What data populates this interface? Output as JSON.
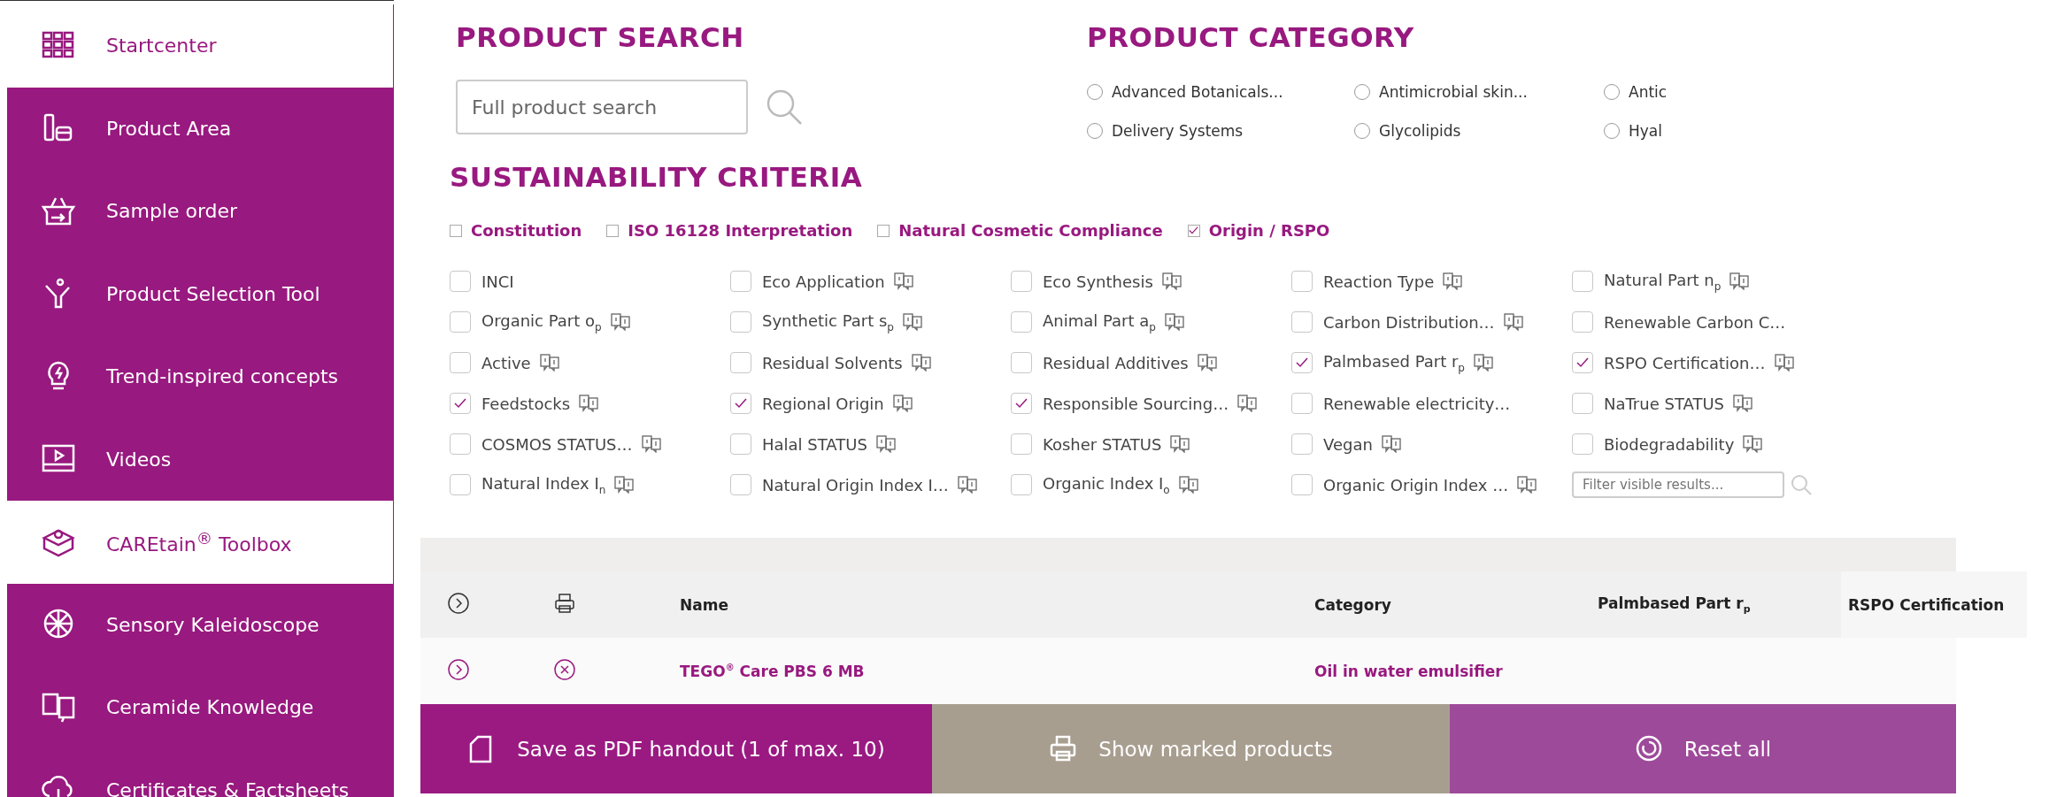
{
  "sidebar": {
    "items": [
      {
        "label": "Startcenter",
        "selected": true
      },
      {
        "label": "Product Area",
        "selected": false
      },
      {
        "label": "Sample order",
        "selected": false
      },
      {
        "label": "Product Selection Tool",
        "selected": false
      },
      {
        "label": "Trend-inspired concepts",
        "selected": false
      },
      {
        "label": "Videos",
        "selected": false
      },
      {
        "label": "CAREtain$^{®}$ Toolbox",
        "selected": true
      },
      {
        "label": "Sensory Kaleidoscope",
        "selected": false
      },
      {
        "label": "Ceramide Knowledge",
        "selected": false
      },
      {
        "label": "Certificates & Factsheets",
        "selected": false
      }
    ]
  },
  "product_search": {
    "title": "PRODUCT SEARCH",
    "placeholder": "Full product search"
  },
  "product_category": {
    "title": "PRODUCT CATEGORY",
    "options": [
      {
        "label": "Advanced Botanicals...",
        "selected": false
      },
      {
        "label": "Antimicrobial skin...",
        "selected": false
      },
      {
        "label": "Antic",
        "selected": false
      },
      {
        "label": "Delivery Systems",
        "selected": false
      },
      {
        "label": "Glycolipids",
        "selected": false
      },
      {
        "label": "Hyal",
        "selected": false
      }
    ]
  },
  "sustainability_criteria": {
    "title": "SUSTAINABILITY CRITERIA",
    "groups": [
      {
        "label": "Constitution",
        "checked": false
      },
      {
        "label": "ISO 16128 Interpretation",
        "checked": false
      },
      {
        "label": "Natural Cosmetic Compliance",
        "checked": false
      },
      {
        "label": "Origin / RSPO",
        "checked": true
      }
    ],
    "criteria": [
      {
        "label": "INCI",
        "checked": false,
        "info_icon": false
      },
      {
        "label": "Eco Application",
        "checked": false,
        "info_icon": true
      },
      {
        "label": "Eco Synthesis",
        "checked": false,
        "info_icon": true
      },
      {
        "label": "Reaction Type",
        "checked": false,
        "info_icon": true
      },
      {
        "label": "Natural Part n$_{p}$",
        "checked": false,
        "info_icon": true
      },
      {
        "label": "Organic Part o$_{p}$",
        "checked": false,
        "info_icon": true
      },
      {
        "label": "Synthetic Part s$_{p}$",
        "checked": false,
        "info_icon": true
      },
      {
        "label": "Animal Part a$_{p}$",
        "checked": false,
        "info_icon": true
      },
      {
        "label": "Carbon Distribution…",
        "checked": false,
        "info_icon": true
      },
      {
        "label": "Renewable Carbon C…",
        "checked": false,
        "info_icon": false
      },
      {
        "label": "Active",
        "checked": false,
        "info_icon": true
      },
      {
        "label": "Residual Solvents",
        "checked": false,
        "info_icon": true
      },
      {
        "label": "Residual Additives",
        "checked": false,
        "info_icon": true
      },
      {
        "label": "Palmbased Part r$_{p}$",
        "checked": true,
        "info_icon": true
      },
      {
        "label": "RSPO Certification…",
        "checked": true,
        "info_icon": true
      },
      {
        "label": "Feedstocks",
        "checked": true,
        "info_icon": true
      },
      {
        "label": "Regional Origin",
        "checked": true,
        "info_icon": true
      },
      {
        "label": "Responsible Sourcing…",
        "checked": true,
        "info_icon": true
      },
      {
        "label": "Renewable electricity…",
        "checked": false,
        "info_icon": false
      },
      {
        "label": "NaTrue STATUS",
        "checked": false,
        "info_icon": true
      },
      {
        "label": "COSMOS STATUS…",
        "checked": false,
        "info_icon": true
      },
      {
        "label": "Halal STATUS",
        "checked": false,
        "info_icon": true
      },
      {
        "label": "Kosher STATUS",
        "checked": false,
        "info_icon": true
      },
      {
        "label": "Vegan",
        "checked": false,
        "info_icon": true
      },
      {
        "label": "Biodegradability",
        "checked": false,
        "info_icon": true
      },
      {
        "label": "Natural Index I$_{n}$",
        "checked": false,
        "info_icon": true
      },
      {
        "label": "Natural Origin Index I…",
        "checked": false,
        "info_icon": true
      },
      {
        "label": "Organic Index I$_{o}$",
        "checked": false,
        "info_icon": true
      },
      {
        "label": "Organic Origin Index …",
        "checked": false,
        "info_icon": true
      }
    ],
    "filter": {
      "placeholder": "Filter visible results..."
    }
  },
  "table": {
    "columns": [
      "Name",
      "Category",
      "Palmbased Part r$_{p}$",
      "RSPO Certification"
    ],
    "rows": [
      {
        "name": "TEGO$^{®}$ Care PBS 6 MB",
        "category": "Oil in water emulsifier"
      }
    ]
  },
  "buttons": [
    {
      "label": "Save as PDF handout (1 of max. 10)"
    },
    {
      "label": "Show marked products"
    },
    {
      "label": "Reset all"
    }
  ]
}
